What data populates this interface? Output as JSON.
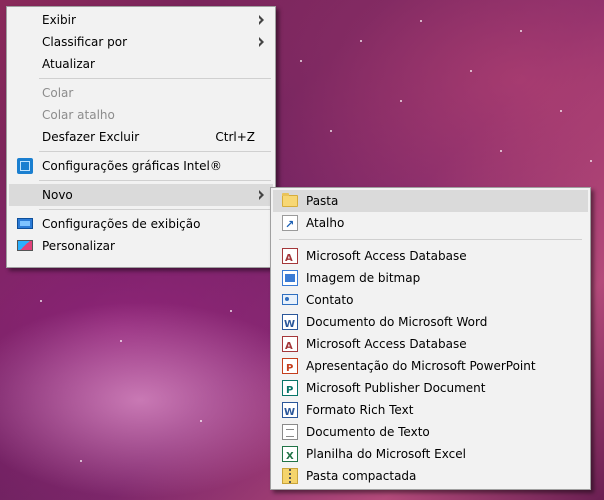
{
  "main_menu": {
    "items": [
      {
        "label": "Exibir",
        "submenu": true
      },
      {
        "label": "Classificar por",
        "submenu": true
      },
      {
        "label": "Atualizar"
      },
      {
        "label": "Colar",
        "disabled": true
      },
      {
        "label": "Colar atalho",
        "disabled": true
      },
      {
        "label": "Desfazer Excluir",
        "shortcut": "Ctrl+Z"
      },
      {
        "label": "Configurações gráficas Intel®",
        "icon": "intel-graphics-icon"
      },
      {
        "label": "Novo",
        "submenu": true,
        "highlighted": true
      },
      {
        "label": "Configurações de exibição",
        "icon": "display-settings-icon"
      },
      {
        "label": "Personalizar",
        "icon": "personalize-icon"
      }
    ]
  },
  "new_submenu": {
    "items": [
      {
        "label": "Pasta",
        "icon": "folder-icon",
        "highlighted": true
      },
      {
        "label": "Atalho",
        "icon": "shortcut-icon"
      },
      {
        "label": "Microsoft Access Database",
        "icon": "access-icon"
      },
      {
        "label": "Imagem de bitmap",
        "icon": "bitmap-icon"
      },
      {
        "label": "Contato",
        "icon": "contact-icon"
      },
      {
        "label": "Documento do Microsoft Word",
        "icon": "word-icon"
      },
      {
        "label": "Microsoft Access Database",
        "icon": "access-icon"
      },
      {
        "label": "Apresentação do Microsoft PowerPoint",
        "icon": "powerpoint-icon"
      },
      {
        "label": "Microsoft Publisher Document",
        "icon": "publisher-icon"
      },
      {
        "label": "Formato Rich Text",
        "icon": "rich-text-icon"
      },
      {
        "label": "Documento de Texto",
        "icon": "text-document-icon"
      },
      {
        "label": "Planilha do Microsoft Excel",
        "icon": "excel-icon"
      },
      {
        "label": "Pasta compactada",
        "icon": "zip-folder-icon"
      }
    ]
  },
  "colors": {
    "menu_bg": "#f2f2f2",
    "highlight_bg": "#dadada",
    "disabled_text": "#8c8c8c"
  }
}
